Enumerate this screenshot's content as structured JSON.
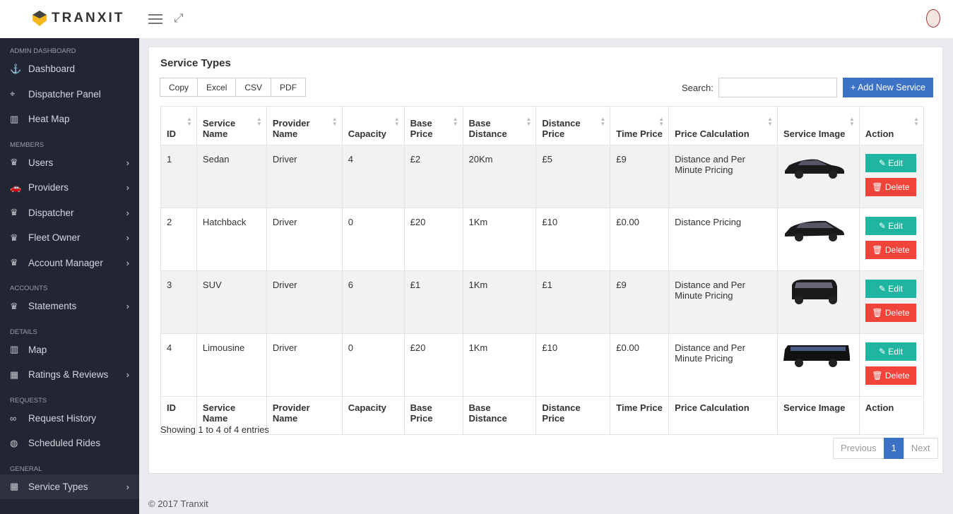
{
  "header": {
    "brand": "TRANXIT"
  },
  "sidebar": {
    "sections": [
      {
        "title": "ADMIN DASHBOARD",
        "items": [
          {
            "label": "Dashboard",
            "icon": "anchor-icon"
          },
          {
            "label": "Dispatcher Panel",
            "icon": "crosshair-icon"
          },
          {
            "label": "Heat Map",
            "icon": "map-icon"
          }
        ]
      },
      {
        "title": "MEMBERS",
        "items": [
          {
            "label": "Users",
            "icon": "crown-icon",
            "chev": true
          },
          {
            "label": "Providers",
            "icon": "car-icon",
            "chev": true
          },
          {
            "label": "Dispatcher",
            "icon": "crown-icon",
            "chev": true
          },
          {
            "label": "Fleet Owner",
            "icon": "crown-icon",
            "chev": true
          },
          {
            "label": "Account Manager",
            "icon": "crown-icon",
            "chev": true
          }
        ]
      },
      {
        "title": "ACCOUNTS",
        "items": [
          {
            "label": "Statements",
            "icon": "crown-icon",
            "chev": true
          }
        ]
      },
      {
        "title": "DETAILS",
        "items": [
          {
            "label": "Map",
            "icon": "map-icon"
          },
          {
            "label": "Ratings & Reviews",
            "icon": "grid-icon",
            "chev": true
          }
        ]
      },
      {
        "title": "REQUESTS",
        "items": [
          {
            "label": "Request History",
            "icon": "infinity-icon"
          },
          {
            "label": "Scheduled Rides",
            "icon": "globe-icon"
          }
        ]
      },
      {
        "title": "GENERAL",
        "items": [
          {
            "label": "Service Types",
            "icon": "grid-icon",
            "chev": true,
            "active": true
          }
        ]
      }
    ]
  },
  "page": {
    "title": "Service Types",
    "export_buttons": [
      "Copy",
      "Excel",
      "CSV",
      "PDF"
    ],
    "search_label": "Search:",
    "search_value": "",
    "add_button": "+ Add New Service"
  },
  "table": {
    "headers": [
      "ID",
      "Service Name",
      "Provider Name",
      "Capacity",
      "Base Price",
      "Base Distance",
      "Distance Price",
      "Time Price",
      "Price Calculation",
      "Service Image",
      "Action"
    ],
    "rows": [
      {
        "id": "1",
        "name": "Sedan",
        "provider": "Driver",
        "capacity": "4",
        "base_price": "£2",
        "base_distance": "20Km",
        "distance_price": "£5",
        "time_price": "£9",
        "calc": "Distance and Per Minute Pricing",
        "image": "sedan"
      },
      {
        "id": "2",
        "name": "Hatchback",
        "provider": "Driver",
        "capacity": "0",
        "base_price": "£20",
        "base_distance": "1Km",
        "distance_price": "£10",
        "time_price": "£0.00",
        "calc": "Distance Pricing",
        "image": "hatchback"
      },
      {
        "id": "3",
        "name": "SUV",
        "provider": "Driver",
        "capacity": "6",
        "base_price": "£1",
        "base_distance": "1Km",
        "distance_price": "£1",
        "time_price": "£9",
        "calc": "Distance and Per Minute Pricing",
        "image": "suv"
      },
      {
        "id": "4",
        "name": "Limousine",
        "provider": "Driver",
        "capacity": "0",
        "base_price": "£20",
        "base_distance": "1Km",
        "distance_price": "£10",
        "time_price": "£0.00",
        "calc": "Distance and Per Minute Pricing",
        "image": "limousine"
      }
    ],
    "edit_label": "✎ Edit",
    "delete_label": "🗑 Delete"
  },
  "info": "Showing 1 to 4 of 4 entries",
  "pagination": {
    "prev": "Previous",
    "current": "1",
    "next": "Next"
  },
  "footer": "© 2017 Tranxit"
}
